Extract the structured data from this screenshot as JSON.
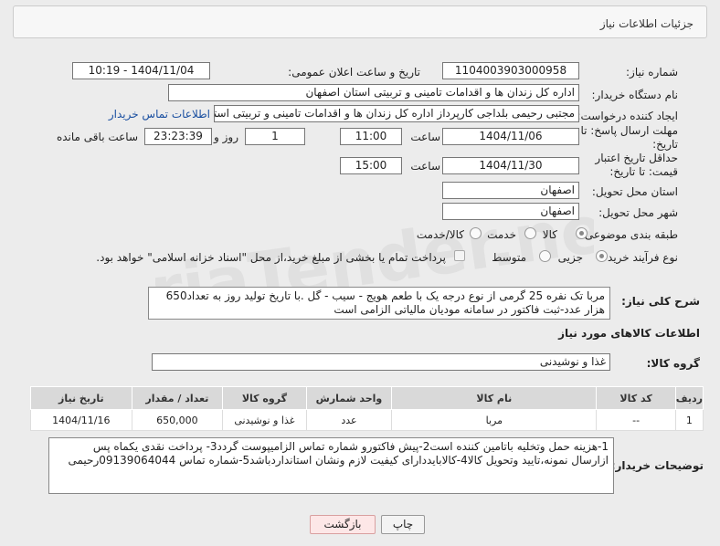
{
  "header": {
    "title": "جزئیات اطلاعات نیاز"
  },
  "fields": {
    "need_number_label": "شماره نیاز:",
    "need_number": "1104003903000958",
    "announce_label": "تاریخ و ساعت اعلان عمومی:",
    "announce_value": "1404/11/04 - 10:19",
    "buyer_org_label": "نام دستگاه خریدار:",
    "buyer_org": "اداره کل زندان ها و اقدامات تامینی و تربیتی استان اصفهان",
    "requester_label": "ایجاد کننده درخواست:",
    "requester": "مجتبی رحیمی بلداجی کارپرداز اداره کل زندان ها و اقدامات تامینی و تربیتی استان اصفهان",
    "contact_link": "اطلاعات تماس خریدار",
    "deadline_label": "مهلت ارسال پاسخ: تا تاریخ:",
    "deadline_date": "1404/11/06",
    "time_label": "ساعت",
    "deadline_time": "11:00",
    "days_value": "1",
    "days_label": "روز و",
    "remaining_time": "23:23:39",
    "remaining_label": "ساعت باقی مانده",
    "validity_label": "حداقل تاریخ اعتبار قیمت: تا تاریخ:",
    "validity_date": "1404/11/30",
    "validity_time": "15:00",
    "province_label": "استان محل تحویل:",
    "province": "اصفهان",
    "city_label": "شهر محل تحویل:",
    "city": "اصفهان"
  },
  "category": {
    "label": "طبقه بندی موضوعی:",
    "options": [
      "کالا",
      "خدمت",
      "کالا/خدمت"
    ],
    "selected": "کالا"
  },
  "process": {
    "label": "نوع فرآیند خرید :",
    "options": [
      "جزیی",
      "متوسط"
    ],
    "selected": "جزیی",
    "note": "پرداخت تمام یا بخشی از مبلغ خرید،از محل \"اسناد خزانه اسلامی\" خواهد بود."
  },
  "description": {
    "label": "شرح کلی نیاز:",
    "text": "مربا تک نفره 25 گرمی از نوع درجه یک با طعم هویج - سیب - گل .با تاریخ تولید روز به تعداد650 هزار عدد-ثبت فاکتور در سامانه مودیان مالیاتی الزامی است"
  },
  "goods": {
    "section_title": "اطلاعات کالاهای مورد نیاز",
    "group_label": "گروه کالا:",
    "group_value": "غذا و نوشیدنی",
    "columns": [
      "ردیف",
      "کد کالا",
      "نام کالا",
      "واحد شمارش",
      "گروه کالا",
      "تعداد / مقدار",
      "تاریخ نیاز"
    ],
    "rows": [
      [
        "1",
        "--",
        "مربا",
        "عدد",
        "غذا و نوشیدنی",
        "650,000",
        "1404/11/16"
      ]
    ]
  },
  "buyer_notes": {
    "label": "توضیحات خریدار:",
    "text": "1-هزینه حمل وتخلیه باتامین کننده است2-پیش فاکتورو شماره تماس الزامیپوست گردد3- پرداخت نقدی یکماه  پس ازارسال نمونه،تایید وتحویل کالا4-کالابایددارای کیفیت لازم ونشان استانداردباشد5-شماره تماس 09139064044رحیمی"
  },
  "buttons": {
    "print": "چاپ",
    "back": "بازگشت"
  },
  "watermark": {
    "text": "AriaTender.neT"
  }
}
